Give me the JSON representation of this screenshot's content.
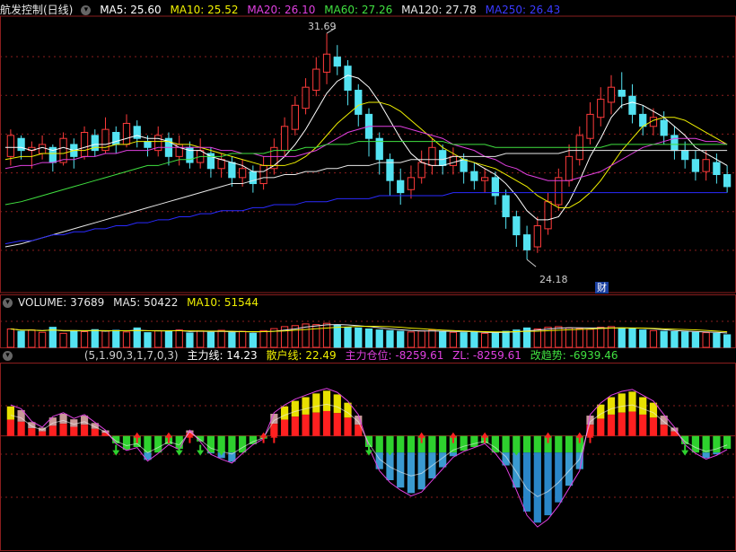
{
  "header_main": {
    "name": "航发控制(日线)",
    "ma5": "MA5: 25.60",
    "ma10": "MA10: 25.52",
    "ma20": "MA20: 26.10",
    "ma60": "MA60: 27.26",
    "ma120": "MA120: 27.78",
    "ma250": "MA250: 26.43"
  },
  "header_volume": {
    "volume": "VOLUME: 37689",
    "ma5": "MA5: 50422",
    "ma10": "MA10: 51544"
  },
  "header_indicator": {
    "params": "(5,1.90,3,1,7,0,3)",
    "zhuli": "主力线: 14.23",
    "sanhu": "散户线: 22.49",
    "cangwei": "主力仓位: -8259.61",
    "zl": "ZL: -8259.61",
    "qushi": "改趋势: -6939.46"
  },
  "annotations": {
    "high_label": "31.69",
    "low_label": "24.18",
    "cai_badge": "财"
  },
  "colors": {
    "up": "#ff3b3b",
    "down": "#54e3f2",
    "ma5": "#ffffff",
    "ma10": "#f0f000",
    "ma20": "#e040e0",
    "ma60": "#40e040",
    "ma120": "#e8e8e8",
    "ma250": "#2a2aff",
    "grid": "#8a1e1e"
  },
  "chart_data": [
    {
      "type": "candlestick",
      "title": "航发控制(日线)",
      "ylim": [
        23.2,
        32.2
      ],
      "high_mark": 31.69,
      "low_mark": 24.18,
      "candles": [
        [
          27.6,
          28.3,
          27.3,
          28.5
        ],
        [
          28.2,
          27.8,
          27.5,
          28.3
        ],
        [
          27.8,
          27.9,
          27.2,
          28.1
        ],
        [
          27.7,
          28.0,
          27.5,
          28.3
        ],
        [
          27.9,
          27.4,
          27.1,
          28.0
        ],
        [
          27.4,
          28.2,
          27.3,
          28.4
        ],
        [
          28.0,
          27.6,
          27.2,
          28.2
        ],
        [
          27.6,
          28.4,
          27.5,
          28.6
        ],
        [
          28.3,
          27.8,
          27.6,
          28.5
        ],
        [
          27.8,
          28.5,
          27.7,
          28.9
        ],
        [
          28.4,
          28.0,
          27.7,
          28.6
        ],
        [
          28.0,
          28.7,
          27.9,
          29.0
        ],
        [
          28.6,
          28.2,
          27.9,
          28.8
        ],
        [
          28.1,
          27.9,
          27.6,
          28.3
        ],
        [
          27.8,
          28.3,
          27.6,
          28.6
        ],
        [
          28.2,
          27.6,
          27.3,
          28.4
        ],
        [
          27.6,
          28.0,
          27.3,
          28.3
        ],
        [
          27.9,
          27.4,
          27.2,
          28.1
        ],
        [
          27.4,
          27.8,
          27.2,
          28.2
        ],
        [
          27.7,
          27.2,
          26.9,
          27.9
        ],
        [
          27.2,
          27.5,
          26.9,
          27.7
        ],
        [
          27.4,
          26.9,
          26.6,
          27.6
        ],
        [
          26.9,
          27.2,
          26.6,
          27.5
        ],
        [
          27.1,
          26.7,
          26.4,
          27.3
        ],
        [
          26.7,
          27.3,
          26.5,
          27.6
        ],
        [
          27.2,
          27.9,
          27.0,
          28.2
        ],
        [
          27.8,
          28.6,
          27.6,
          28.9
        ],
        [
          28.5,
          29.3,
          28.3,
          29.6
        ],
        [
          29.2,
          29.9,
          29.0,
          30.2
        ],
        [
          29.8,
          30.5,
          29.6,
          30.9
        ],
        [
          30.4,
          31.0,
          30.0,
          31.69
        ],
        [
          30.9,
          30.6,
          30.3,
          31.3
        ],
        [
          30.6,
          29.8,
          29.3,
          30.8
        ],
        [
          29.8,
          29.0,
          28.6,
          30.0
        ],
        [
          29.0,
          28.2,
          27.6,
          29.2
        ],
        [
          28.2,
          27.5,
          27.0,
          28.4
        ],
        [
          27.5,
          26.8,
          26.3,
          27.7
        ],
        [
          26.8,
          26.4,
          26.0,
          27.2
        ],
        [
          26.5,
          26.9,
          26.2,
          27.3
        ],
        [
          26.9,
          27.4,
          26.7,
          27.8
        ],
        [
          27.3,
          27.9,
          27.0,
          28.2
        ],
        [
          27.8,
          27.3,
          27.0,
          28.0
        ],
        [
          27.3,
          27.6,
          27.0,
          27.9
        ],
        [
          27.5,
          27.1,
          26.7,
          27.7
        ],
        [
          27.1,
          26.8,
          26.5,
          27.4
        ],
        [
          26.8,
          26.9,
          26.4,
          27.2
        ],
        [
          26.9,
          26.3,
          26.0,
          27.1
        ],
        [
          26.3,
          25.6,
          25.2,
          26.5
        ],
        [
          25.6,
          25.0,
          24.6,
          25.8
        ],
        [
          25.0,
          24.5,
          24.18,
          25.3
        ],
        [
          24.6,
          25.3,
          24.4,
          25.6
        ],
        [
          25.2,
          26.1,
          25.0,
          26.4
        ],
        [
          26.0,
          26.9,
          25.8,
          27.2
        ],
        [
          26.8,
          27.6,
          26.6,
          28.0
        ],
        [
          27.5,
          28.3,
          27.3,
          28.6
        ],
        [
          28.2,
          29.0,
          28.0,
          29.4
        ],
        [
          28.9,
          29.5,
          28.6,
          29.9
        ],
        [
          29.4,
          29.9,
          29.0,
          30.3
        ],
        [
          29.8,
          29.6,
          29.2,
          30.4
        ],
        [
          29.6,
          29.0,
          28.7,
          30.0
        ],
        [
          29.0,
          28.6,
          28.3,
          29.3
        ],
        [
          28.6,
          28.9,
          28.3,
          29.2
        ],
        [
          28.8,
          28.3,
          28.0,
          29.1
        ],
        [
          28.3,
          27.8,
          27.5,
          28.6
        ],
        [
          27.8,
          27.5,
          27.2,
          28.1
        ],
        [
          27.5,
          27.1,
          26.8,
          27.8
        ],
        [
          27.1,
          27.5,
          26.8,
          27.8
        ],
        [
          27.4,
          27.0,
          26.7,
          27.7
        ],
        [
          27.0,
          26.6,
          26.4,
          27.3
        ]
      ],
      "ma_lines": {
        "MA5": [
          27.9,
          27.9,
          27.8,
          27.9,
          27.8,
          27.9,
          27.8,
          27.9,
          28.0,
          28.0,
          28.1,
          28.2,
          28.3,
          28.2,
          28.2,
          28.1,
          27.9,
          27.8,
          27.8,
          27.6,
          27.5,
          27.4,
          27.3,
          27.1,
          27.1,
          27.3,
          27.6,
          28.0,
          28.5,
          29.1,
          29.7,
          30.1,
          30.3,
          30.2,
          29.9,
          29.4,
          28.8,
          28.2,
          27.7,
          27.4,
          27.3,
          27.3,
          27.4,
          27.5,
          27.4,
          27.2,
          27.0,
          26.7,
          26.3,
          25.8,
          25.5,
          25.5,
          25.6,
          26.1,
          26.8,
          27.6,
          28.2,
          28.9,
          29.3,
          29.4,
          29.3,
          29.1,
          28.9,
          28.6,
          28.3,
          27.9,
          27.7,
          27.5,
          27.3
        ],
        "MA10": [
          27.5,
          27.6,
          27.6,
          27.7,
          27.7,
          27.7,
          27.8,
          27.8,
          27.9,
          27.9,
          28.0,
          28.0,
          28.1,
          28.1,
          28.1,
          28.1,
          28.0,
          28.0,
          27.9,
          27.8,
          27.7,
          27.6,
          27.5,
          27.4,
          27.3,
          27.3,
          27.3,
          27.4,
          27.6,
          27.9,
          28.3,
          28.7,
          29.0,
          29.3,
          29.4,
          29.4,
          29.3,
          29.1,
          28.8,
          28.5,
          28.2,
          27.9,
          27.7,
          27.5,
          27.4,
          27.3,
          27.2,
          27.0,
          26.8,
          26.6,
          26.3,
          26.1,
          25.9,
          25.9,
          26.1,
          26.4,
          26.8,
          27.3,
          27.8,
          28.2,
          28.6,
          28.8,
          28.9,
          28.9,
          28.8,
          28.6,
          28.4,
          28.2,
          28.0
        ],
        "MA20": [
          27.2,
          27.3,
          27.3,
          27.4,
          27.4,
          27.5,
          27.5,
          27.6,
          27.6,
          27.7,
          27.7,
          27.8,
          27.8,
          27.8,
          27.9,
          27.9,
          27.9,
          27.9,
          27.9,
          27.9,
          27.8,
          27.8,
          27.7,
          27.7,
          27.6,
          27.6,
          27.6,
          27.6,
          27.7,
          27.8,
          28.0,
          28.2,
          28.4,
          28.5,
          28.6,
          28.6,
          28.6,
          28.6,
          28.5,
          28.4,
          28.3,
          28.2,
          28.0,
          27.9,
          27.8,
          27.6,
          27.5,
          27.3,
          27.2,
          27.0,
          26.9,
          26.8,
          26.8,
          26.8,
          26.9,
          27.0,
          27.1,
          27.3,
          27.5,
          27.7,
          27.9,
          28.0,
          28.1,
          28.2,
          28.2,
          28.2,
          28.1,
          28.1,
          28.0
        ],
        "MA60": [
          26.0,
          26.1,
          26.2,
          26.3,
          26.4,
          26.5,
          26.6,
          26.7,
          26.8,
          26.9,
          27.0,
          27.1,
          27.2,
          27.3,
          27.3,
          27.4,
          27.5,
          27.5,
          27.6,
          27.6,
          27.6,
          27.7,
          27.7,
          27.7,
          27.7,
          27.8,
          27.8,
          27.8,
          27.9,
          27.9,
          28.0,
          28.0,
          28.0,
          28.1,
          28.1,
          28.1,
          28.1,
          28.1,
          28.1,
          28.1,
          28.1,
          28.1,
          28.0,
          28.0,
          28.0,
          28.0,
          27.9,
          27.9,
          27.9,
          27.9,
          27.9,
          27.9,
          27.9,
          27.9,
          27.9,
          27.9,
          27.9,
          28.0,
          28.0,
          28.0,
          28.0,
          28.0,
          28.0,
          28.0,
          28.0,
          28.0,
          28.0,
          28.0,
          28.0
        ],
        "MA120": [
          24.6,
          24.7,
          24.8,
          24.9,
          25.0,
          25.1,
          25.2,
          25.3,
          25.4,
          25.5,
          25.6,
          25.7,
          25.8,
          25.9,
          26.0,
          26.1,
          26.2,
          26.3,
          26.4,
          26.5,
          26.6,
          26.7,
          26.7,
          26.8,
          26.9,
          26.9,
          27.0,
          27.0,
          27.1,
          27.1,
          27.2,
          27.2,
          27.3,
          27.3,
          27.3,
          27.4,
          27.4,
          27.4,
          27.5,
          27.5,
          27.5,
          27.5,
          27.6,
          27.6,
          27.6,
          27.6,
          27.6,
          27.7,
          27.7,
          27.7,
          27.7,
          27.7,
          27.7,
          27.8,
          27.8,
          27.8,
          27.8,
          27.8,
          27.8,
          27.8,
          27.8,
          27.8,
          27.8,
          27.8,
          27.8,
          27.8,
          27.8,
          27.8,
          27.8
        ],
        "MA250": [
          24.7,
          24.8,
          24.8,
          24.9,
          25.0,
          25.0,
          25.1,
          25.1,
          25.2,
          25.2,
          25.3,
          25.3,
          25.4,
          25.4,
          25.5,
          25.5,
          25.6,
          25.6,
          25.7,
          25.7,
          25.8,
          25.8,
          25.8,
          25.9,
          25.9,
          26.0,
          26.0,
          26.0,
          26.1,
          26.1,
          26.1,
          26.2,
          26.2,
          26.2,
          26.2,
          26.3,
          26.3,
          26.3,
          26.3,
          26.3,
          26.3,
          26.3,
          26.4,
          26.4,
          26.4,
          26.4,
          26.4,
          26.4,
          26.4,
          26.4,
          26.4,
          26.4,
          26.4,
          26.4,
          26.4,
          26.4,
          26.4,
          26.4,
          26.4,
          26.4,
          26.4,
          26.4,
          26.4,
          26.4,
          26.4,
          26.4,
          26.4,
          26.4,
          26.4
        ]
      }
    },
    {
      "type": "bar",
      "title": "VOLUME",
      "ylim": [
        0,
        110000
      ],
      "values": [
        55000,
        48000,
        52000,
        45000,
        60000,
        42000,
        50000,
        47000,
        53000,
        49000,
        51000,
        46000,
        58000,
        44000,
        50000,
        47000,
        52000,
        43000,
        49000,
        45000,
        51000,
        44000,
        48000,
        42000,
        50000,
        56000,
        62000,
        65000,
        70000,
        68000,
        72000,
        66000,
        60000,
        58000,
        55000,
        52000,
        50000,
        48000,
        46000,
        49000,
        52000,
        47000,
        45000,
        44000,
        46000,
        42000,
        45000,
        48000,
        52000,
        58000,
        55000,
        60000,
        62000,
        58000,
        56000,
        54000,
        60000,
        62000,
        58000,
        55000,
        52000,
        50000,
        48000,
        47000,
        46000,
        45000,
        44000,
        42000,
        37689
      ],
      "ma5": 50422,
      "ma10": 51544
    },
    {
      "type": "bar",
      "title": "主力线/散户线",
      "ylim": [
        -12000,
        6000
      ],
      "values": [
        3200,
        2800,
        1500,
        900,
        2000,
        2400,
        1800,
        2200,
        1400,
        600,
        -800,
        -1500,
        -1200,
        -2600,
        -1800,
        -900,
        -1400,
        600,
        -600,
        -1900,
        -2400,
        -2800,
        -1800,
        -900,
        -300,
        2400,
        3200,
        3800,
        4200,
        4600,
        4900,
        4500,
        3600,
        2200,
        -1200,
        -3600,
        -4800,
        -5600,
        -6200,
        -5800,
        -4600,
        -3400,
        -2200,
        -1600,
        -1200,
        -800,
        -1800,
        -3200,
        -5600,
        -8200,
        -9400,
        -8600,
        -7200,
        -5400,
        -3600,
        2200,
        3400,
        4200,
        4600,
        4800,
        4200,
        3600,
        2200,
        900,
        -900,
        -1800,
        -2400,
        -2000,
        -1400
      ],
      "series": [
        {
          "name": "主力线",
          "latest": 14.23
        },
        {
          "name": "散户线",
          "latest": 22.49
        }
      ]
    }
  ]
}
